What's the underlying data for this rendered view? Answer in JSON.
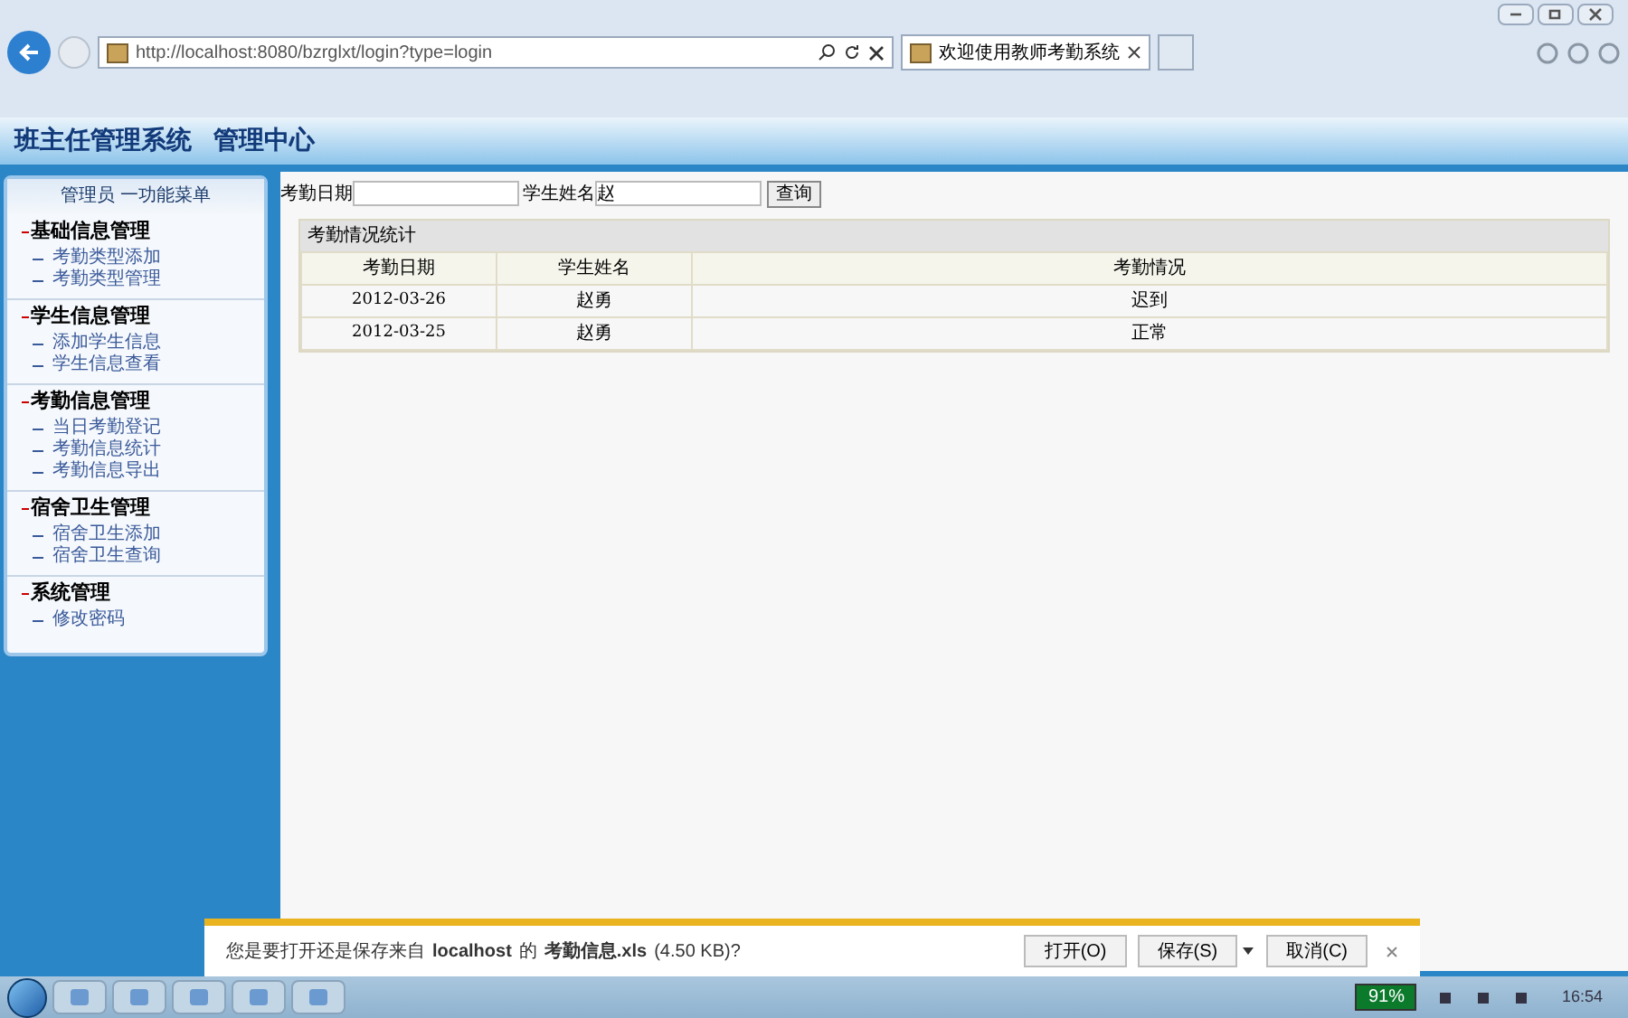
{
  "browser": {
    "address": "http://localhost:8080/bzrglxt/login?type=login",
    "tabs": [
      {
        "label": "欢迎使用教师考勤系统",
        "selected": true
      }
    ]
  },
  "header": {
    "title": "班主任管理系统",
    "subtitle": "管理中心"
  },
  "sidebar": {
    "title": "管理员 一功能菜单",
    "groups": [
      {
        "label": "基础信息管理",
        "items": [
          "考勤类型添加",
          "考勤类型管理"
        ]
      },
      {
        "label": "学生信息管理",
        "items": [
          "添加学生信息",
          "学生信息查看"
        ]
      },
      {
        "label": "考勤信息管理",
        "items": [
          "当日考勤登记",
          "考勤信息统计",
          "考勤信息导出"
        ]
      },
      {
        "label": "宿舍卫生管理",
        "items": [
          "宿舍卫生添加",
          "宿舍卫生查询"
        ]
      },
      {
        "label": "系统管理",
        "items": [
          "修改密码"
        ]
      }
    ]
  },
  "search": {
    "date_label": "考勤日期",
    "name_label": "学生姓名",
    "name_value": "赵",
    "button": "查询"
  },
  "table": {
    "title": "考勤情况统计",
    "columns": [
      "考勤日期",
      "学生姓名",
      "考勤情况"
    ],
    "rows": [
      [
        "2012-03-26",
        "赵勇",
        "迟到"
      ],
      [
        "2012-03-25",
        "赵勇",
        "正常"
      ]
    ]
  },
  "download_bar": {
    "prefix": "您是要打开还是保存来自",
    "host": "localhost",
    "middle": "的",
    "file": "考勤信息.xls",
    "size": "(4.50 KB)?",
    "buttons": [
      "打开(O)",
      "保存(S)",
      "取消(C)"
    ]
  },
  "taskbar": {
    "battery": "91%",
    "time": "16:54"
  }
}
